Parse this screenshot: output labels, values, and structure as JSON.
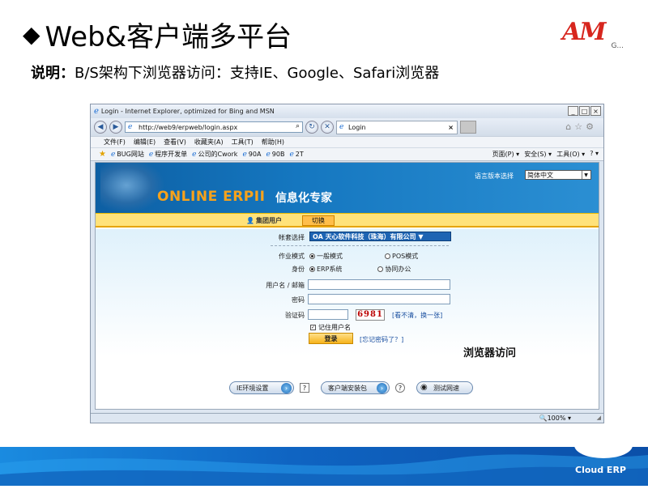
{
  "slide": {
    "title": "Web&客户端多平台",
    "title_marker": "◆",
    "logo_text": "AM",
    "logo_suffix": "G...",
    "subtitle_label": "说明：",
    "subtitle_text": "B/S架构下浏览器访问：支持IE、Google、Safari浏览器",
    "footer_brand": "Cloud ERP"
  },
  "browser": {
    "window_title": "Login - Internet Explorer, optimized for Bing and MSN",
    "window_buttons": [
      "_",
      "□",
      "×"
    ],
    "address": "http://web9/erpweb/login.aspx",
    "tab_title": "Login",
    "menu": [
      "文件(F)",
      "编辑(E)",
      "查看(V)",
      "收藏夹(A)",
      "工具(T)",
      "帮助(H)"
    ],
    "favorites": [
      "BUG网站",
      "程序开发单",
      "公司的Cwork",
      "90A",
      "90B",
      "2T"
    ],
    "commands": [
      "页面(P) ▾",
      "安全(S) ▾",
      "工具(O) ▾",
      "? ▾"
    ],
    "zoom": "100%"
  },
  "page": {
    "brand": "ONLINE ERPII",
    "brand_cn": "信息化专家",
    "lang_label": "语言版本选择",
    "lang_value": "简体中文",
    "tab_group": "集团用户",
    "tab_switch": "切换",
    "account_label": "帐套选择",
    "account_value": "OA 天心软件科技（珠海）有限公司 ▼",
    "mode_label": "作业模式",
    "mode_options": [
      "一般模式",
      "POS模式"
    ],
    "identity_label": "身份",
    "identity_options": [
      "ERP系统",
      "协同办公"
    ],
    "username_label": "用户名 / 邮箱",
    "password_label": "密码",
    "captcha_label": "验证码",
    "captcha_value": "6981",
    "captcha_link": "[看不清，换一张]",
    "remember_label": "记住用户名",
    "login_button": "登录",
    "forgot_link": "[忘记密码了？]",
    "annotation": "浏览器访问",
    "btn_ie_settings": "IE环境设置",
    "btn_client_install": "客户端安装包",
    "btn_test_net": "测试网速"
  }
}
